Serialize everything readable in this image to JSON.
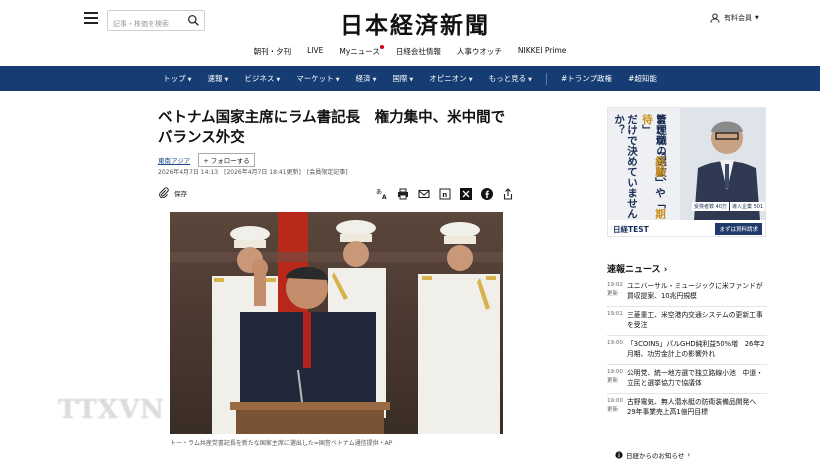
{
  "header": {
    "logo": "日本経済新聞",
    "search_placeholder": "記事・株価を検索",
    "account_label": "有料会員"
  },
  "subnav": [
    "朝刊・夕刊",
    "LIVE",
    "Myニュース",
    "日経会社情報",
    "人事ウオッチ",
    "NIKKEI Prime"
  ],
  "mainnav": {
    "items": [
      {
        "label": "トップ",
        "dropdown": true
      },
      {
        "label": "速報",
        "dropdown": true
      },
      {
        "label": "ビジネス",
        "dropdown": true
      },
      {
        "label": "マーケット",
        "dropdown": true
      },
      {
        "label": "経済",
        "dropdown": true
      },
      {
        "label": "国際",
        "dropdown": true
      },
      {
        "label": "オピニオン",
        "dropdown": true
      },
      {
        "label": "もっと見る",
        "dropdown": true
      }
    ],
    "hashtags": [
      "#トランプ政権",
      "#超知能"
    ]
  },
  "article": {
    "title": "ベトナム国家主席にラム書記長　権力集中、米中間でバランス外交",
    "tag": "東南アジア",
    "follow_label": "+ フォローする",
    "dateline": "2026年4月7日 14:13　[2026年4月7日 18:41更新]　[会員限定記事]",
    "save_label": "保存",
    "caption": "トー・ラム共産党書記長を新たな国家主席に選出した=国営ベトナム通信提供・AP",
    "watermark": "TTXVN"
  },
  "ad": {
    "col1": "管理職の選抜、",
    "col2_a": "まさか「",
    "col2_b": "経験",
    "col2_c": "」や「",
    "col2_d": "期待",
    "col2_e": "」",
    "col3": "だけで決めていませんか？",
    "stat1": "受検者数 40万",
    "stat2": "導入企業 501",
    "brand": "日経TEST",
    "cta": "まずは資料請求"
  },
  "news": {
    "heading": "速報ニュース",
    "items": [
      {
        "time": "19:02",
        "badge": "更新",
        "text": "ユニバーサル・ミュージックに米ファンドが買収提案、10兆円規模"
      },
      {
        "time": "19:01",
        "badge": "",
        "text": "三菱重工、米空港内交通システムの更新工事を受注"
      },
      {
        "time": "19:00",
        "badge": "",
        "text": "「3COINS」パルGHD純利益50%増　26年2月期、功労金計上の影響外れ"
      },
      {
        "time": "19:00",
        "badge": "更新",
        "text": "公明党、統一地方選で独立路線小池　中道・立民と選挙協力で協議体"
      },
      {
        "time": "19:00",
        "badge": "更新",
        "text": "古野電気、無人潜水艇の防衛装備品開発へ　29年事業売上高1億円目標"
      }
    ]
  },
  "notice_label": "日経からのお知らせ",
  "colors": {
    "nav_bg": "#153c73",
    "link": "#1a4b8c",
    "accent_dot": "#d0021b",
    "ad_gold": "#c98e1a"
  }
}
